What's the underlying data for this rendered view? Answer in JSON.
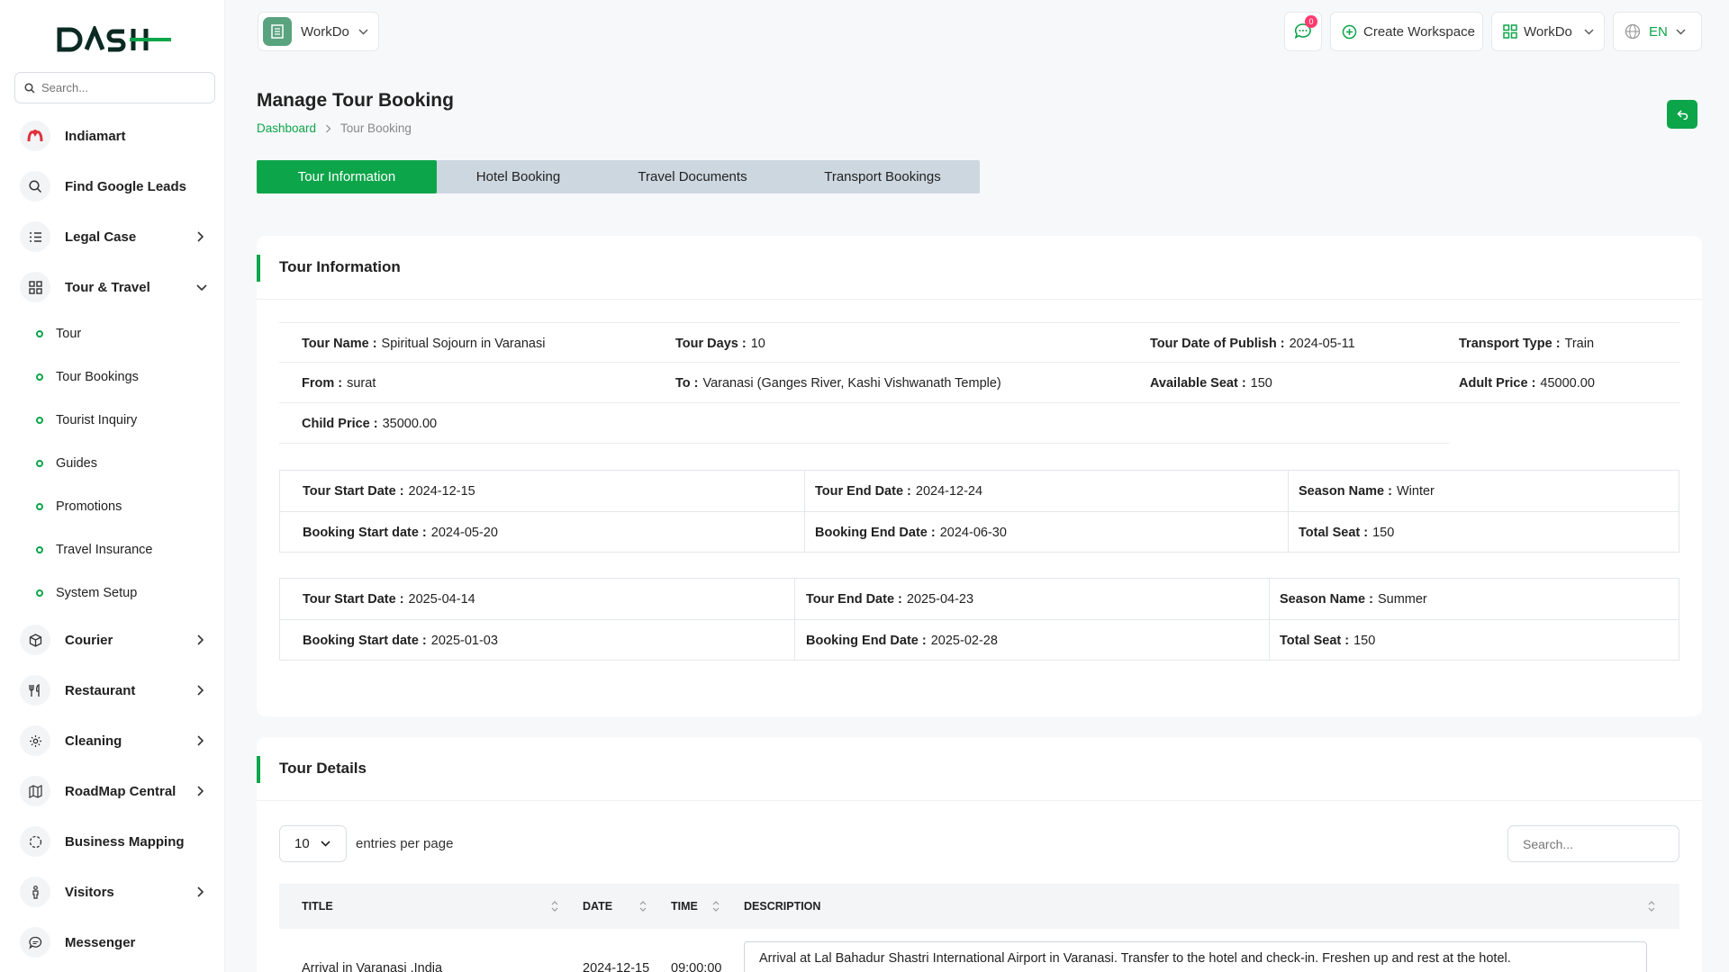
{
  "brand": {
    "logo_text": "DASH"
  },
  "sidebar": {
    "search_placeholder": "Search...",
    "items": [
      {
        "label": "Indiamart",
        "icon": "indiamart-logo-icon"
      },
      {
        "label": "Find Google Leads",
        "icon": "search-icon"
      },
      {
        "label": "Legal Case",
        "icon": "list-icon",
        "chevron": "right"
      },
      {
        "label": "Tour & Travel",
        "icon": "grid-icon",
        "chevron": "down"
      }
    ],
    "sub_items": [
      "Tour",
      "Tour Bookings",
      "Tourist Inquiry",
      "Guides",
      "Promotions",
      "Travel Insurance",
      "System Setup"
    ],
    "items_after": [
      {
        "label": "Courier",
        "icon": "box-icon",
        "chevron": "right"
      },
      {
        "label": "Restaurant",
        "icon": "utensils-icon",
        "chevron": "right"
      },
      {
        "label": "Cleaning",
        "icon": "sparkle-icon",
        "chevron": "right"
      },
      {
        "label": "RoadMap Central",
        "icon": "map-icon",
        "chevron": "right"
      },
      {
        "label": "Business Mapping",
        "icon": "circle-dashed-icon"
      },
      {
        "label": "Visitors",
        "icon": "person-icon",
        "chevron": "right"
      },
      {
        "label": "Messenger",
        "icon": "chat-icon"
      }
    ]
  },
  "topbar": {
    "workspace": "WorkDo",
    "notification_count": "0",
    "create_workspace": "Create Workspace",
    "workdo_menu": "WorkDo",
    "language": "EN"
  },
  "page": {
    "title": "Manage Tour Booking",
    "breadcrumb": [
      "Dashboard",
      "Tour Booking"
    ]
  },
  "tabs": [
    "Tour Information",
    "Hotel Booking",
    "Travel Documents",
    "Transport Bookings"
  ],
  "tour_info": {
    "title": "Tour Information",
    "fields": {
      "tour_name": {
        "label": "Tour Name :",
        "value": "Spiritual Sojourn in Varanasi"
      },
      "tour_days": {
        "label": "Tour Days :",
        "value": "10"
      },
      "publish": {
        "label": "Tour Date of Publish :",
        "value": "2024-05-11"
      },
      "transport": {
        "label": "Transport Type :",
        "value": "Train"
      },
      "from": {
        "label": "From :",
        "value": "surat"
      },
      "to": {
        "label": "To :",
        "value": "Varanasi (Ganges River, Kashi Vishwanath Temple)"
      },
      "available_seat": {
        "label": "Available Seat :",
        "value": "150"
      },
      "adult_price": {
        "label": "Adult Price :",
        "value": "45000.00"
      },
      "child_price": {
        "label": "Child Price :",
        "value": "35000.00"
      }
    },
    "seasons": [
      {
        "tour_start": {
          "label": "Tour Start Date :",
          "value": "2024-12-15"
        },
        "tour_end": {
          "label": "Tour End Date :",
          "value": "2024-12-24"
        },
        "season": {
          "label": "Season Name :",
          "value": "Winter"
        },
        "booking_start": {
          "label": "Booking Start date :",
          "value": "2024-05-20"
        },
        "booking_end": {
          "label": "Booking End Date :",
          "value": "2024-06-30"
        },
        "total_seat": {
          "label": "Total Seat :",
          "value": "150"
        }
      },
      {
        "tour_start": {
          "label": "Tour Start Date :",
          "value": "2025-04-14"
        },
        "tour_end": {
          "label": "Tour End Date :",
          "value": "2025-04-23"
        },
        "season": {
          "label": "Season Name :",
          "value": "Summer"
        },
        "booking_start": {
          "label": "Booking Start date :",
          "value": "2025-01-03"
        },
        "booking_end": {
          "label": "Booking End Date :",
          "value": "2025-02-28"
        },
        "total_seat": {
          "label": "Total Seat :",
          "value": "150"
        }
      }
    ]
  },
  "tour_details": {
    "title": "Tour Details",
    "entries_value": "10",
    "entries_label": "entries per page",
    "search_placeholder": "Search...",
    "columns": [
      "TITLE",
      "DATE",
      "TIME",
      "DESCRIPTION"
    ],
    "rows": [
      {
        "title": "Arrival in Varanasi ,India",
        "date": "2024-12-15",
        "time": "09:00:00",
        "description": "Arrival at Lal Bahadur Shastri International Airport in Varanasi. Transfer to the hotel and check-in. Freshen up and rest at the hotel."
      }
    ]
  },
  "colors": {
    "accent": "#0da54a",
    "tab_bar": "#cdd7e0",
    "badge": "#ff3a6e"
  }
}
